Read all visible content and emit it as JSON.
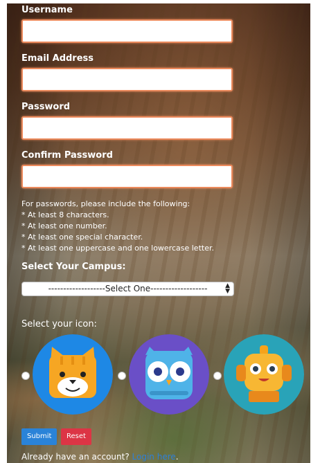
{
  "form": {
    "username_label": "Username",
    "email_label": "Email Address",
    "password_label": "Password",
    "confirm_password_label": "Confirm Password",
    "password_hint_title": "For passwords, please include the following:",
    "password_rules": [
      "* At least 8 characters.",
      "* At least one number.",
      "* At least one special character.",
      "* At least one uppercase and one lowercase letter."
    ],
    "campus_label": "Select Your Campus:",
    "campus_selected": "-------------------Select One-------------------",
    "icon_label": "Select your icon:",
    "icons": [
      {
        "name": "cat-icon",
        "bg": "#1e88e5"
      },
      {
        "name": "owl-icon",
        "bg": "#6a4fc7"
      },
      {
        "name": "robot-icon",
        "bg": "#29a3b8"
      }
    ],
    "submit_label": "Submit",
    "reset_label": "Reset",
    "login_prompt": "Already have an account?",
    "login_link": "Login here",
    "login_suffix": "."
  }
}
